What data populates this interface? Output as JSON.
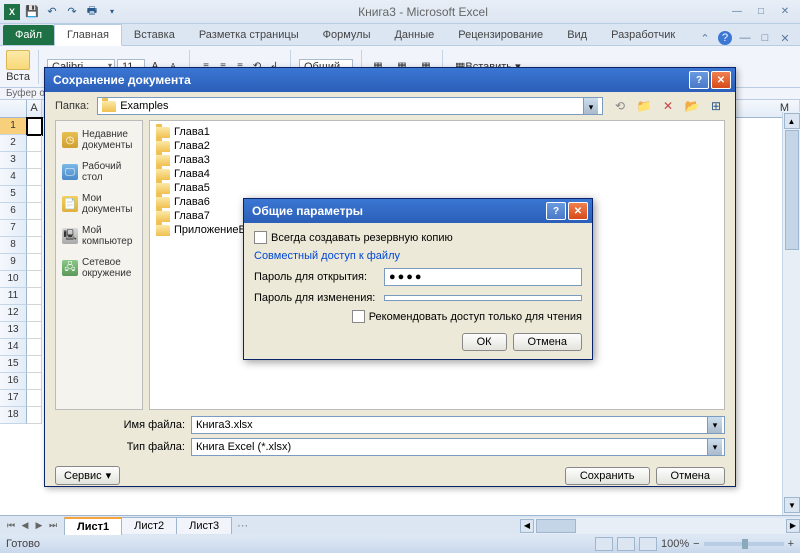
{
  "app": {
    "title": "Книга3  -  Microsoft Excel"
  },
  "ribbon": {
    "file": "Файл",
    "tabs": [
      "Главная",
      "Вставка",
      "Разметка страницы",
      "Формулы",
      "Данные",
      "Рецензирование",
      "Вид",
      "Разработчик"
    ],
    "paste_label": "Вста",
    "clipboard_label": "Буфер о",
    "font_name": "Calibri",
    "font_size": "11",
    "number_format": "Общий",
    "insert_label": "Вставить"
  },
  "grid": {
    "columns": [
      "A",
      "M"
    ],
    "visible_rows": 18
  },
  "sheets": {
    "tabs": [
      "Лист1",
      "Лист2",
      "Лист3"
    ]
  },
  "status": {
    "text": "Готово",
    "zoom": "100%"
  },
  "save_dialog": {
    "title": "Сохранение документа",
    "folder_label": "Папка:",
    "folder_value": "Examples",
    "places": {
      "recent": "Недавние документы",
      "desktop": "Рабочий стол",
      "mydocs": "Мои документы",
      "mycomp": "Мой компьютер",
      "network": "Сетевое окружение"
    },
    "files": [
      "Глава1",
      "Глава2",
      "Глава3",
      "Глава4",
      "Глава5",
      "Глава6",
      "Глава7",
      "ПриложениеB"
    ],
    "filename_label": "Имя файла:",
    "filename_value": "Книга3.xlsx",
    "filetype_label": "Тип файла:",
    "filetype_value": "Книга Excel (*.xlsx)",
    "service": "Сервис",
    "save": "Сохранить",
    "cancel": "Отмена"
  },
  "options_dialog": {
    "title": "Общие параметры",
    "backup_label": "Всегда создавать резервную копию",
    "share_link": "Совместный доступ к файлу",
    "pwd_open_label": "Пароль для открытия:",
    "pwd_open_value": "●●●●",
    "pwd_modify_label": "Пароль для изменения:",
    "pwd_modify_value": "",
    "readonly_label": "Рекомендовать доступ только для чтения",
    "ok": "ОК",
    "cancel": "Отмена"
  }
}
